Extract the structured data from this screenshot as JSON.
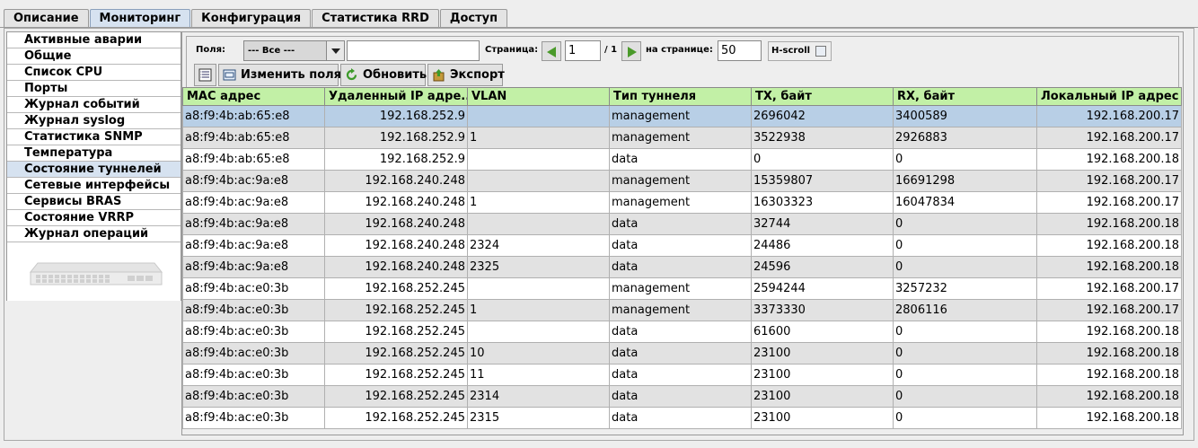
{
  "tabs": [
    "Описание",
    "Мониторинг",
    "Конфигурация",
    "Статистика RRD",
    "Доступ"
  ],
  "active_tab": 1,
  "sidebar": {
    "items": [
      "Активные аварии",
      "Общие",
      "Список CPU",
      "Порты",
      "Журнал событий",
      "Журнал syslog",
      "Статистика SNMP",
      "Температура",
      "Состояние туннелей",
      "Сетевые интерфейсы",
      "Сервисы BRAS",
      "Состояние VRRP",
      "Журнал операций"
    ],
    "active_index": 8
  },
  "toolbar": {
    "fields_label": "Поля:",
    "fields_value": "--- Все ---",
    "search_value": "",
    "page_label": "Страница:",
    "page_value": "1",
    "page_total": "/ 1",
    "per_page_label": "на странице:",
    "per_page_value": "50",
    "hscroll_label": "H-scroll",
    "change_fields_label": "Изменить поля",
    "refresh_label": "Обновить",
    "export_label": "Экспорт"
  },
  "table": {
    "columns": [
      "MAC адрес",
      "Удаленный IP адре...",
      "VLAN",
      "Тип туннеля",
      "TX, байт",
      "RX, байт",
      "Локальный IP адрес"
    ],
    "rows": [
      [
        "a8:f9:4b:ab:65:e8",
        "192.168.252.9",
        "",
        "management",
        "2696042",
        "3400589",
        "192.168.200.17"
      ],
      [
        "a8:f9:4b:ab:65:e8",
        "192.168.252.9",
        "1",
        "management",
        "3522938",
        "2926883",
        "192.168.200.17"
      ],
      [
        "a8:f9:4b:ab:65:e8",
        "192.168.252.9",
        "",
        "data",
        "0",
        "0",
        "192.168.200.18"
      ],
      [
        "a8:f9:4b:ac:9a:e8",
        "192.168.240.248",
        "",
        "management",
        "15359807",
        "16691298",
        "192.168.200.17"
      ],
      [
        "a8:f9:4b:ac:9a:e8",
        "192.168.240.248",
        "1",
        "management",
        "16303323",
        "16047834",
        "192.168.200.17"
      ],
      [
        "a8:f9:4b:ac:9a:e8",
        "192.168.240.248",
        "",
        "data",
        "32744",
        "0",
        "192.168.200.18"
      ],
      [
        "a8:f9:4b:ac:9a:e8",
        "192.168.240.248",
        "2324",
        "data",
        "24486",
        "0",
        "192.168.200.18"
      ],
      [
        "a8:f9:4b:ac:9a:e8",
        "192.168.240.248",
        "2325",
        "data",
        "24596",
        "0",
        "192.168.200.18"
      ],
      [
        "a8:f9:4b:ac:e0:3b",
        "192.168.252.245",
        "",
        "management",
        "2594244",
        "3257232",
        "192.168.200.17"
      ],
      [
        "a8:f9:4b:ac:e0:3b",
        "192.168.252.245",
        "1",
        "management",
        "3373330",
        "2806116",
        "192.168.200.17"
      ],
      [
        "a8:f9:4b:ac:e0:3b",
        "192.168.252.245",
        "",
        "data",
        "61600",
        "0",
        "192.168.200.18"
      ],
      [
        "a8:f9:4b:ac:e0:3b",
        "192.168.252.245",
        "10",
        "data",
        "23100",
        "0",
        "192.168.200.18"
      ],
      [
        "a8:f9:4b:ac:e0:3b",
        "192.168.252.245",
        "11",
        "data",
        "23100",
        "0",
        "192.168.200.18"
      ],
      [
        "a8:f9:4b:ac:e0:3b",
        "192.168.252.245",
        "2314",
        "data",
        "23100",
        "0",
        "192.168.200.18"
      ],
      [
        "a8:f9:4b:ac:e0:3b",
        "192.168.252.245",
        "2315",
        "data",
        "23100",
        "0",
        "192.168.200.18"
      ]
    ],
    "selected_row": 0
  },
  "colors": {
    "header_bg": "#c2f0a6",
    "selected_row": "#b8cfe6",
    "active_tab": "#d6e2f0",
    "nav_arrow": "#4a9a2a"
  },
  "icons": {
    "fields": "combo-dropdown-icon",
    "prev": "arrow-left-icon",
    "next": "arrow-right-icon",
    "list": "list-view-icon",
    "change_fields": "columns-icon",
    "refresh": "refresh-icon",
    "export": "export-icon"
  }
}
